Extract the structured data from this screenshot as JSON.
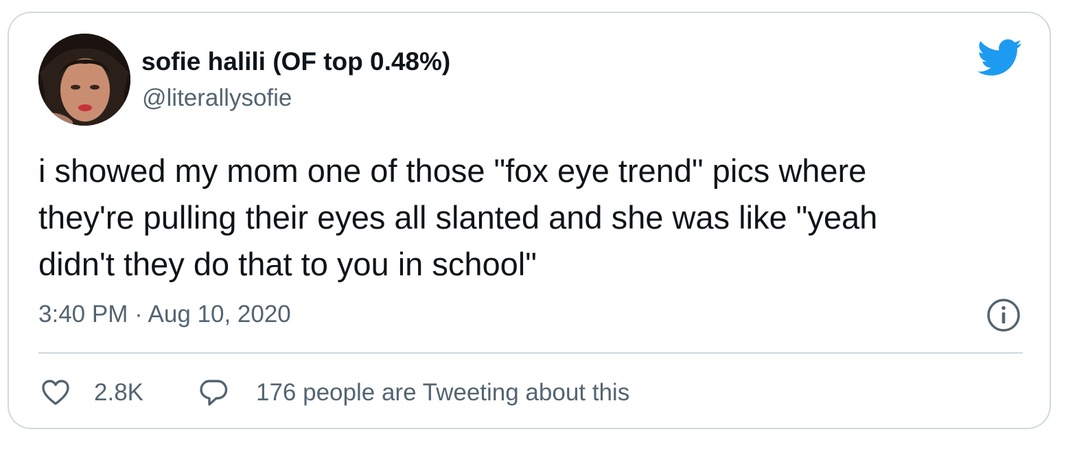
{
  "tweet": {
    "author": {
      "display_name": "sofie halili (OF top 0.48%)",
      "handle": "@literallysofie",
      "avatar": "profile-photo"
    },
    "text": "i showed my mom one of those \"fox eye trend\" pics where\nthey're pulling their eyes all slanted and she was like \"yeah\ndidn't they do that to you in school\"",
    "timestamp": "3:40 PM · Aug 10, 2020",
    "likes": "2.8K",
    "replies_label": "176 people are Tweeting about this",
    "icons": {
      "brand": "twitter-bird-icon",
      "info": "info-icon",
      "like": "heart-icon",
      "reply": "speech-bubble-icon"
    },
    "colors": {
      "brand": "#1d9bf0",
      "text": "#0f1419",
      "muted": "#536471",
      "border": "#cfd9de"
    }
  }
}
